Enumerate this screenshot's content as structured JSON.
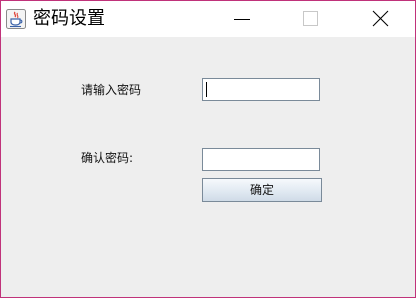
{
  "window": {
    "title": "密码设置"
  },
  "icons": {
    "app": "java-coffee-cup-icon",
    "minimize": "minimize-icon",
    "maximize": "maximize-icon",
    "close": "close-icon"
  },
  "form": {
    "password_label": "请输入密码",
    "password_value": "",
    "confirm_label": "确认密码:",
    "confirm_value": "",
    "submit_label": "确定"
  },
  "colors": {
    "window_border": "#c0327a",
    "background": "#eeeeee",
    "titlebar": "#ffffff"
  }
}
